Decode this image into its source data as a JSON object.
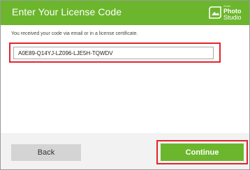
{
  "dialog": {
    "title": "Enter Your License Code",
    "logo": {
      "brand": "Zoner",
      "line1": "Photo",
      "line2": "Studio",
      "icon": "photo-studio-logo-icon"
    },
    "instruction": "You received your code via email or in a license certificate.",
    "license_code": "A0E89-Q14YJ-LZ096-LJE5H-TQWDV"
  },
  "buttons": {
    "back_label": "Back",
    "continue_label": "Continue"
  },
  "colors": {
    "header_green": "#6cb62d",
    "continue_green": "#6cb62d",
    "highlight_red": "#e2242b",
    "back_gray": "#d4d4d4",
    "footer_gray": "#f2f2f2"
  }
}
